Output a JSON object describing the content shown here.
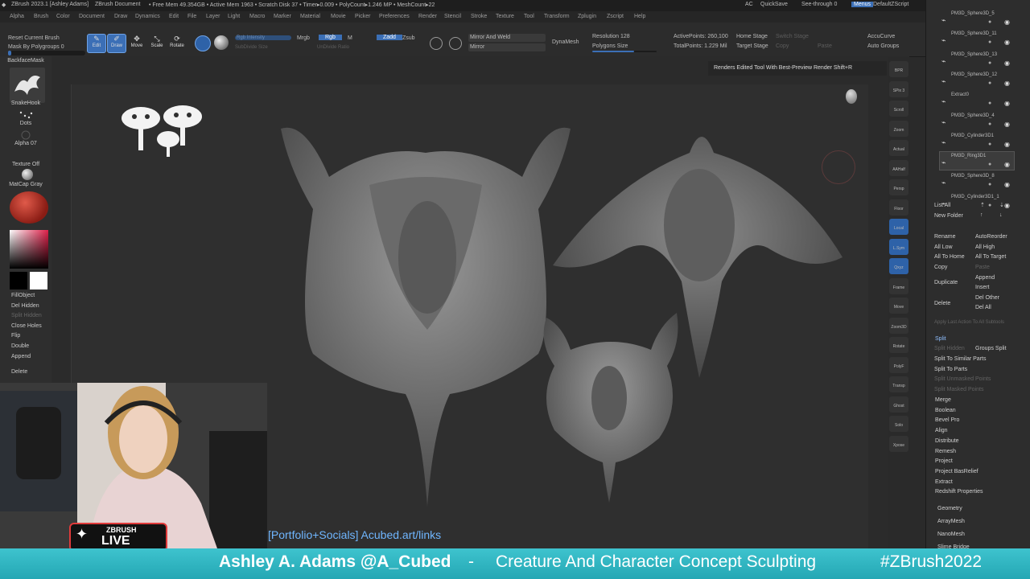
{
  "window": {
    "title": "ZBrush 2023.1 [Ashley Adams]",
    "doc_label": "ZBrush Document",
    "stats": "• Free Mem 49.354GB • Active Mem 1963 • Scratch Disk 37 • Timer▸0.009 • PolyCount▸1.246 MP • MeshCount▸22",
    "ac": "AC",
    "quicksave": "QuickSave",
    "seethrough": "See-through  0",
    "menus_btn": "Menus",
    "script": "DefaultZScript"
  },
  "menubar": [
    "Alpha",
    "Brush",
    "Color",
    "Document",
    "Draw",
    "Dynamics",
    "Edit",
    "File",
    "Layer",
    "Light",
    "Macro",
    "Marker",
    "Material",
    "Movie",
    "Picker",
    "Preferences",
    "Render",
    "Stencil",
    "Stroke",
    "Texture",
    "Tool",
    "Transform",
    "Zplugin",
    "Zscript",
    "Help"
  ],
  "toolbar": {
    "reset_brush": "Reset Current Brush",
    "mask_polygroups": "Mask By Polygroups 0",
    "edit": "Edit",
    "draw": "Draw",
    "move": "Move",
    "scale": "Scale",
    "rotate": "Rotate",
    "mrgb": "Mrgb",
    "rgb": "Rgb",
    "m": "M",
    "zadd": "Zadd",
    "zsub": "Zsub",
    "rgb_intensity": "Rgb Intensity",
    "z_intensity": "Z Intensity",
    "subdivide_size": "SubDivide Size",
    "undivide_ratio": "UnDivide Ratio",
    "mirror_weld": "Mirror And Weld",
    "mirror": "Mirror",
    "dynamesh": "DynaMesh",
    "resolution": "Resolution 128",
    "polygons_size": "Polygons Size",
    "active_points": "ActivePoints: 260,100",
    "total_points": "TotalPoints: 1.229 Mil",
    "home_stage": "Home Stage",
    "switch_stage": "Switch Stage",
    "target_stage": "Target Stage",
    "copy": "Copy",
    "paste": "Paste",
    "accucurve": "AccuCurve",
    "auto_groups": "Auto Groups",
    "tooltip": "Renders Edited Tool With Best-Preview Render  Shift+R"
  },
  "left_shelf": {
    "backface": "BackfaceMask",
    "brush": "SnakeHook",
    "stroke": "Dots",
    "alpha": "Alpha 07",
    "texture": "Texture Off",
    "material": "MatCap Gray",
    "items": [
      {
        "label": "FillObject",
        "dim": false
      },
      {
        "label": "Del Hidden",
        "dim": false
      },
      {
        "label": "Split Hidden",
        "dim": true
      },
      {
        "label": "Close Holes",
        "dim": false
      },
      {
        "label": "Flip",
        "dim": false
      },
      {
        "label": "Double",
        "dim": false
      },
      {
        "label": "Append",
        "dim": false
      },
      {
        "label": "Delete",
        "dim": false
      }
    ]
  },
  "right_shelf": [
    "BPR",
    "SPix 3",
    "Scroll",
    "Zoom",
    "Actual",
    "AAHalf",
    "Persp",
    "Floor",
    "Local",
    "L.Sym",
    "Qxyz",
    "Frame",
    "Move",
    "Zoom3D",
    "Rotate",
    "PolyF",
    "Transp",
    "Ghost",
    "Solo",
    "Xpose"
  ],
  "subtools": [
    {
      "name": "PM3D_Sphere3D_5",
      "selected": false
    },
    {
      "name": "PM3D_Sphere3D_11",
      "selected": false
    },
    {
      "name": "PM3D_Sphere3D_13",
      "selected": false
    },
    {
      "name": "PM3D_Sphere3D_12",
      "selected": false
    },
    {
      "name": "Extract0",
      "selected": false
    },
    {
      "name": "PM3D_Sphere3D_4",
      "selected": false
    },
    {
      "name": "PM3D_Cylinder3D1",
      "selected": false
    },
    {
      "name": "PM3D_Ring3D1",
      "selected": true
    },
    {
      "name": "PM3D_Sphere3D_8",
      "selected": false
    },
    {
      "name": "PM3D_Cylinder3D1_1",
      "selected": false
    }
  ],
  "tray": {
    "list_all": "List All",
    "new_folder": "New Folder",
    "rename": "Rename",
    "autoreorder": "AutoReorder",
    "all_low": "All Low",
    "all_high": "All High",
    "all_to_home": "All To Home",
    "all_to_target": "All To Target",
    "copy": "Copy",
    "paste": "Paste",
    "append": "Append",
    "duplicate": "Duplicate",
    "insert": "Insert",
    "del_other": "Del Other",
    "delete": "Delete",
    "del_all": "Del All",
    "apply_last": "Apply Last Action To All Subtools",
    "split": "Split",
    "split_hidden": "Split Hidden",
    "groups_split": "Groups Split",
    "split_similar": "Split To Similar Parts",
    "split_parts": "Split To Parts",
    "split_unmasked": "Split Unmasked Points",
    "split_masked": "Split Masked Points",
    "sections": [
      "Merge",
      "Boolean",
      "Bevel Pro",
      "Align",
      "Distribute",
      "Remesh",
      "Project",
      "Project BasRelief",
      "Extract",
      "Redshift Properties"
    ],
    "lower_sections": [
      "Geometry",
      "ArrayMesh",
      "NanoMesh",
      "Slime Bridge"
    ]
  },
  "overlay": {
    "portfolio": "[Portfolio+Socials] Acubed.art/links",
    "logo_top": "ZBRUSH",
    "logo_bottom": "LIVE"
  },
  "banner": {
    "name": "Ashley A. Adams @A_Cubed",
    "dash": "-",
    "tagline": "Creature And Character Concept Sculpting",
    "hashtag": "#ZBrush2022"
  },
  "colors": {
    "accent_blue": "#3b6fb6",
    "banner_teal": "#2fb6c2",
    "portfolio_blue": "#6fb6ff"
  }
}
